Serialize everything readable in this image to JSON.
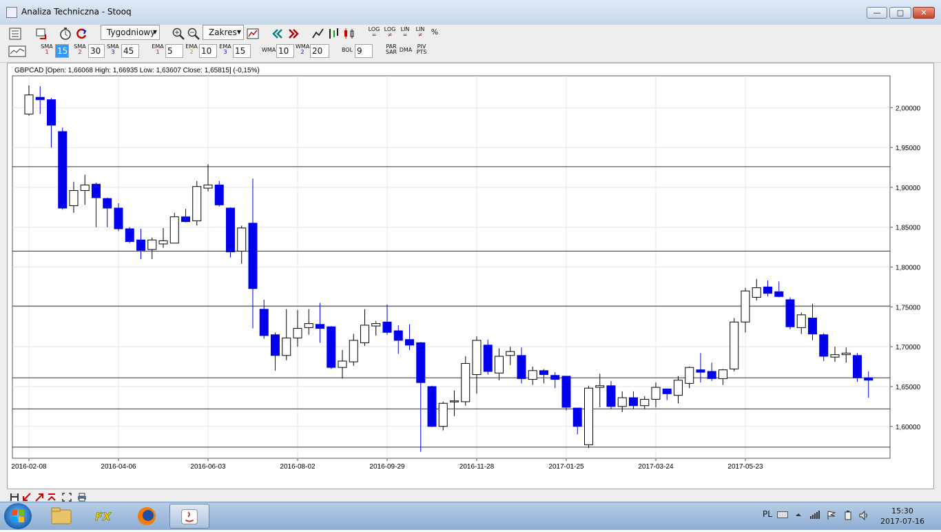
{
  "window": {
    "title": "Analiza Techniczna - Stooq"
  },
  "toolbar": {
    "interval": "Tygodniowy",
    "range": "Zakres",
    "scale_buttons": [
      {
        "top": "LOG",
        "bottom": "="
      },
      {
        "top": "LOG",
        "bottom": "≠"
      },
      {
        "top": "LIN",
        "bottom": "="
      },
      {
        "top": "LIN",
        "bottom": "≠"
      },
      {
        "top": "%",
        "bottom": ""
      }
    ]
  },
  "indicators": {
    "sma1": {
      "label": "SMA",
      "sub": "1",
      "value": "15"
    },
    "sma2": {
      "label": "SMA",
      "sub": "2",
      "value": "30"
    },
    "sma3": {
      "label": "SMA",
      "sub": "3",
      "value": "45"
    },
    "ema1": {
      "label": "EMA",
      "sub": "1",
      "value": "5"
    },
    "ema2": {
      "label": "EMA",
      "sub": "2",
      "value": "10"
    },
    "ema3": {
      "label": "EMA",
      "sub": "3",
      "value": "15"
    },
    "wma1": {
      "label": "WMA",
      "sub": "1",
      "value": "10"
    },
    "wma2": {
      "label": "WMA",
      "sub": "2",
      "value": "20"
    },
    "bol": {
      "label": "BOL",
      "value": "9"
    },
    "parsar": {
      "top": "PAR",
      "bottom": "SAR"
    },
    "dma": {
      "label": "DMA"
    },
    "pivpts": {
      "top": "PIV",
      "bottom": "PTS"
    }
  },
  "chart_data": {
    "type": "candlestick",
    "instrument_label": "GBPCAD [Open: 1,66068  High: 1,66935  Low: 1,63607  Close: 1,65815] (-0,15%)",
    "y_ticks": [
      "2,00000",
      "1,95000",
      "1,90000",
      "1,85000",
      "1,80000",
      "1,75000",
      "1,70000",
      "1,65000",
      "1,60000"
    ],
    "y_tick_values": [
      2.0,
      1.95,
      1.9,
      1.85,
      1.8,
      1.75,
      1.7,
      1.65,
      1.6
    ],
    "ylim": [
      1.56,
      2.04
    ],
    "x_ticks": [
      "2016-02-08",
      "2016-04-06",
      "2016-06-03",
      "2016-08-02",
      "2016-09-29",
      "2016-11-28",
      "2017-01-25",
      "2017-03-24",
      "2017-05-23"
    ],
    "x_tick_index": [
      0,
      8,
      16,
      24,
      32,
      40,
      48,
      56,
      64
    ],
    "horizontal_levels": [
      1.926,
      1.82,
      1.751,
      1.661,
      1.622,
      1.574
    ],
    "grid": true,
    "bull_color": "#ffffff",
    "bear_color": "#0000ee",
    "candles": [
      {
        "o": 1.992,
        "h": 2.028,
        "l": 1.99,
        "c": 2.016
      },
      {
        "o": 2.013,
        "h": 2.027,
        "l": 1.992,
        "c": 2.01
      },
      {
        "o": 2.01,
        "h": 2.012,
        "l": 1.95,
        "c": 1.978
      },
      {
        "o": 1.97,
        "h": 1.975,
        "l": 1.872,
        "c": 1.874
      },
      {
        "o": 1.877,
        "h": 1.907,
        "l": 1.868,
        "c": 1.896
      },
      {
        "o": 1.896,
        "h": 1.916,
        "l": 1.878,
        "c": 1.903
      },
      {
        "o": 1.904,
        "h": 1.906,
        "l": 1.85,
        "c": 1.887
      },
      {
        "o": 1.886,
        "h": 1.887,
        "l": 1.85,
        "c": 1.874
      },
      {
        "o": 1.874,
        "h": 1.88,
        "l": 1.845,
        "c": 1.848
      },
      {
        "o": 1.848,
        "h": 1.85,
        "l": 1.83,
        "c": 1.832
      },
      {
        "o": 1.834,
        "h": 1.848,
        "l": 1.81,
        "c": 1.821
      },
      {
        "o": 1.822,
        "h": 1.837,
        "l": 1.81,
        "c": 1.834
      },
      {
        "o": 1.829,
        "h": 1.849,
        "l": 1.824,
        "c": 1.833
      },
      {
        "o": 1.83,
        "h": 1.868,
        "l": 1.83,
        "c": 1.863
      },
      {
        "o": 1.863,
        "h": 1.873,
        "l": 1.856,
        "c": 1.857
      },
      {
        "o": 1.858,
        "h": 1.908,
        "l": 1.852,
        "c": 1.901
      },
      {
        "o": 1.899,
        "h": 1.929,
        "l": 1.895,
        "c": 1.903
      },
      {
        "o": 1.903,
        "h": 1.908,
        "l": 1.876,
        "c": 1.878
      },
      {
        "o": 1.874,
        "h": 1.875,
        "l": 1.812,
        "c": 1.819
      },
      {
        "o": 1.82,
        "h": 1.852,
        "l": 1.804,
        "c": 1.849
      },
      {
        "o": 1.855,
        "h": 1.911,
        "l": 1.723,
        "c": 1.773
      },
      {
        "o": 1.747,
        "h": 1.759,
        "l": 1.71,
        "c": 1.714
      },
      {
        "o": 1.715,
        "h": 1.718,
        "l": 1.67,
        "c": 1.689
      },
      {
        "o": 1.689,
        "h": 1.747,
        "l": 1.683,
        "c": 1.711
      },
      {
        "o": 1.711,
        "h": 1.746,
        "l": 1.7,
        "c": 1.723
      },
      {
        "o": 1.724,
        "h": 1.747,
        "l": 1.715,
        "c": 1.729
      },
      {
        "o": 1.728,
        "h": 1.755,
        "l": 1.705,
        "c": 1.723
      },
      {
        "o": 1.725,
        "h": 1.726,
        "l": 1.672,
        "c": 1.674
      },
      {
        "o": 1.674,
        "h": 1.696,
        "l": 1.66,
        "c": 1.682
      },
      {
        "o": 1.681,
        "h": 1.716,
        "l": 1.676,
        "c": 1.708
      },
      {
        "o": 1.705,
        "h": 1.747,
        "l": 1.701,
        "c": 1.727
      },
      {
        "o": 1.726,
        "h": 1.732,
        "l": 1.714,
        "c": 1.729
      },
      {
        "o": 1.731,
        "h": 1.753,
        "l": 1.715,
        "c": 1.718
      },
      {
        "o": 1.72,
        "h": 1.727,
        "l": 1.691,
        "c": 1.708
      },
      {
        "o": 1.709,
        "h": 1.728,
        "l": 1.696,
        "c": 1.702
      },
      {
        "o": 1.705,
        "h": 1.706,
        "l": 1.568,
        "c": 1.655
      },
      {
        "o": 1.65,
        "h": 1.651,
        "l": 1.599,
        "c": 1.6
      },
      {
        "o": 1.6,
        "h": 1.631,
        "l": 1.595,
        "c": 1.629
      },
      {
        "o": 1.631,
        "h": 1.645,
        "l": 1.613,
        "c": 1.632
      },
      {
        "o": 1.631,
        "h": 1.688,
        "l": 1.626,
        "c": 1.679
      },
      {
        "o": 1.665,
        "h": 1.713,
        "l": 1.641,
        "c": 1.708
      },
      {
        "o": 1.702,
        "h": 1.709,
        "l": 1.665,
        "c": 1.669
      },
      {
        "o": 1.667,
        "h": 1.698,
        "l": 1.658,
        "c": 1.688
      },
      {
        "o": 1.689,
        "h": 1.7,
        "l": 1.677,
        "c": 1.694
      },
      {
        "o": 1.689,
        "h": 1.699,
        "l": 1.654,
        "c": 1.66
      },
      {
        "o": 1.659,
        "h": 1.675,
        "l": 1.652,
        "c": 1.67
      },
      {
        "o": 1.67,
        "h": 1.672,
        "l": 1.654,
        "c": 1.665
      },
      {
        "o": 1.664,
        "h": 1.668,
        "l": 1.648,
        "c": 1.659
      },
      {
        "o": 1.663,
        "h": 1.663,
        "l": 1.62,
        "c": 1.624
      },
      {
        "o": 1.623,
        "h": 1.623,
        "l": 1.59,
        "c": 1.6
      },
      {
        "o": 1.577,
        "h": 1.651,
        "l": 1.573,
        "c": 1.648
      },
      {
        "o": 1.649,
        "h": 1.666,
        "l": 1.624,
        "c": 1.651
      },
      {
        "o": 1.651,
        "h": 1.657,
        "l": 1.622,
        "c": 1.625
      },
      {
        "o": 1.625,
        "h": 1.644,
        "l": 1.618,
        "c": 1.636
      },
      {
        "o": 1.636,
        "h": 1.644,
        "l": 1.622,
        "c": 1.626
      },
      {
        "o": 1.626,
        "h": 1.638,
        "l": 1.622,
        "c": 1.634
      },
      {
        "o": 1.634,
        "h": 1.655,
        "l": 1.624,
        "c": 1.649
      },
      {
        "o": 1.647,
        "h": 1.647,
        "l": 1.633,
        "c": 1.641
      },
      {
        "o": 1.639,
        "h": 1.663,
        "l": 1.629,
        "c": 1.658
      },
      {
        "o": 1.654,
        "h": 1.675,
        "l": 1.648,
        "c": 1.674
      },
      {
        "o": 1.671,
        "h": 1.692,
        "l": 1.655,
        "c": 1.668
      },
      {
        "o": 1.669,
        "h": 1.68,
        "l": 1.657,
        "c": 1.66
      },
      {
        "o": 1.66,
        "h": 1.672,
        "l": 1.652,
        "c": 1.671
      },
      {
        "o": 1.672,
        "h": 1.736,
        "l": 1.669,
        "c": 1.731
      },
      {
        "o": 1.731,
        "h": 1.774,
        "l": 1.718,
        "c": 1.77
      },
      {
        "o": 1.762,
        "h": 1.785,
        "l": 1.758,
        "c": 1.774
      },
      {
        "o": 1.775,
        "h": 1.783,
        "l": 1.763,
        "c": 1.767
      },
      {
        "o": 1.769,
        "h": 1.782,
        "l": 1.762,
        "c": 1.763
      },
      {
        "o": 1.759,
        "h": 1.762,
        "l": 1.722,
        "c": 1.725
      },
      {
        "o": 1.724,
        "h": 1.743,
        "l": 1.716,
        "c": 1.74
      },
      {
        "o": 1.736,
        "h": 1.754,
        "l": 1.708,
        "c": 1.716
      },
      {
        "o": 1.715,
        "h": 1.717,
        "l": 1.682,
        "c": 1.688
      },
      {
        "o": 1.687,
        "h": 1.7,
        "l": 1.681,
        "c": 1.69
      },
      {
        "o": 1.69,
        "h": 1.699,
        "l": 1.68,
        "c": 1.692
      },
      {
        "o": 1.689,
        "h": 1.692,
        "l": 1.656,
        "c": 1.661
      },
      {
        "o": 1.661,
        "h": 1.669,
        "l": 1.636,
        "c": 1.658
      }
    ]
  },
  "tray": {
    "lang": "PL",
    "time": "15:30",
    "date": "2017-07-16"
  }
}
